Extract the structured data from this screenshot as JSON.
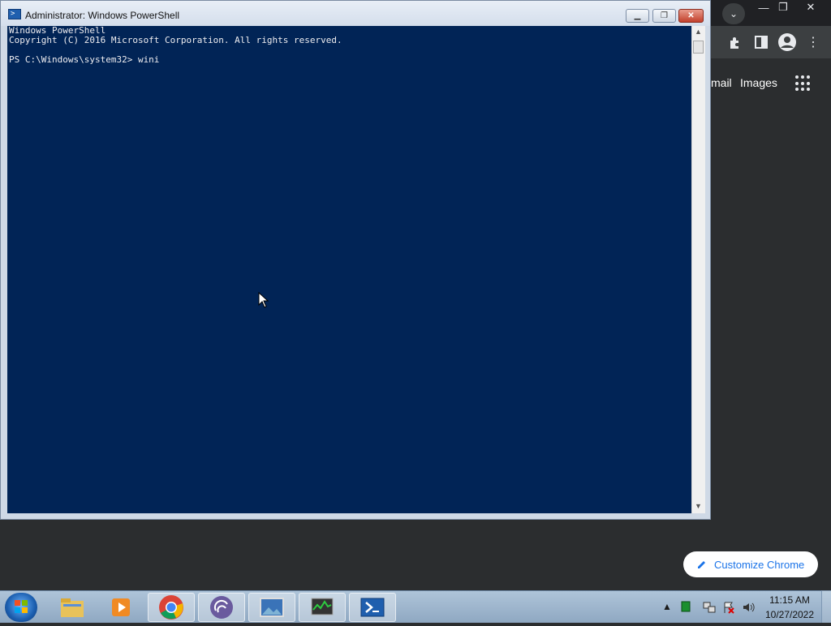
{
  "chrome": {
    "links": {
      "gmail": "mail",
      "images": "Images"
    },
    "customize_label": "Customize Chrome",
    "window_controls": {
      "minimize": "—",
      "restore": "❐",
      "close": "✕"
    }
  },
  "powershell": {
    "title": "Administrator: Windows PowerShell",
    "console_lines": [
      "Windows PowerShell",
      "Copyright (C) 2016 Microsoft Corporation. All rights reserved.",
      "",
      "PS C:\\Windows\\system32> wini"
    ],
    "colors": {
      "console_bg": "#012456",
      "console_fg": "#eeedf0"
    }
  },
  "taskbar": {
    "clock": {
      "time": "11:15 AM",
      "date": "10/27/2022"
    },
    "apps": [
      "file-explorer",
      "media-player",
      "chrome",
      "torrent-client",
      "photo-viewer",
      "task-manager",
      "powershell"
    ],
    "active_app": "powershell"
  }
}
